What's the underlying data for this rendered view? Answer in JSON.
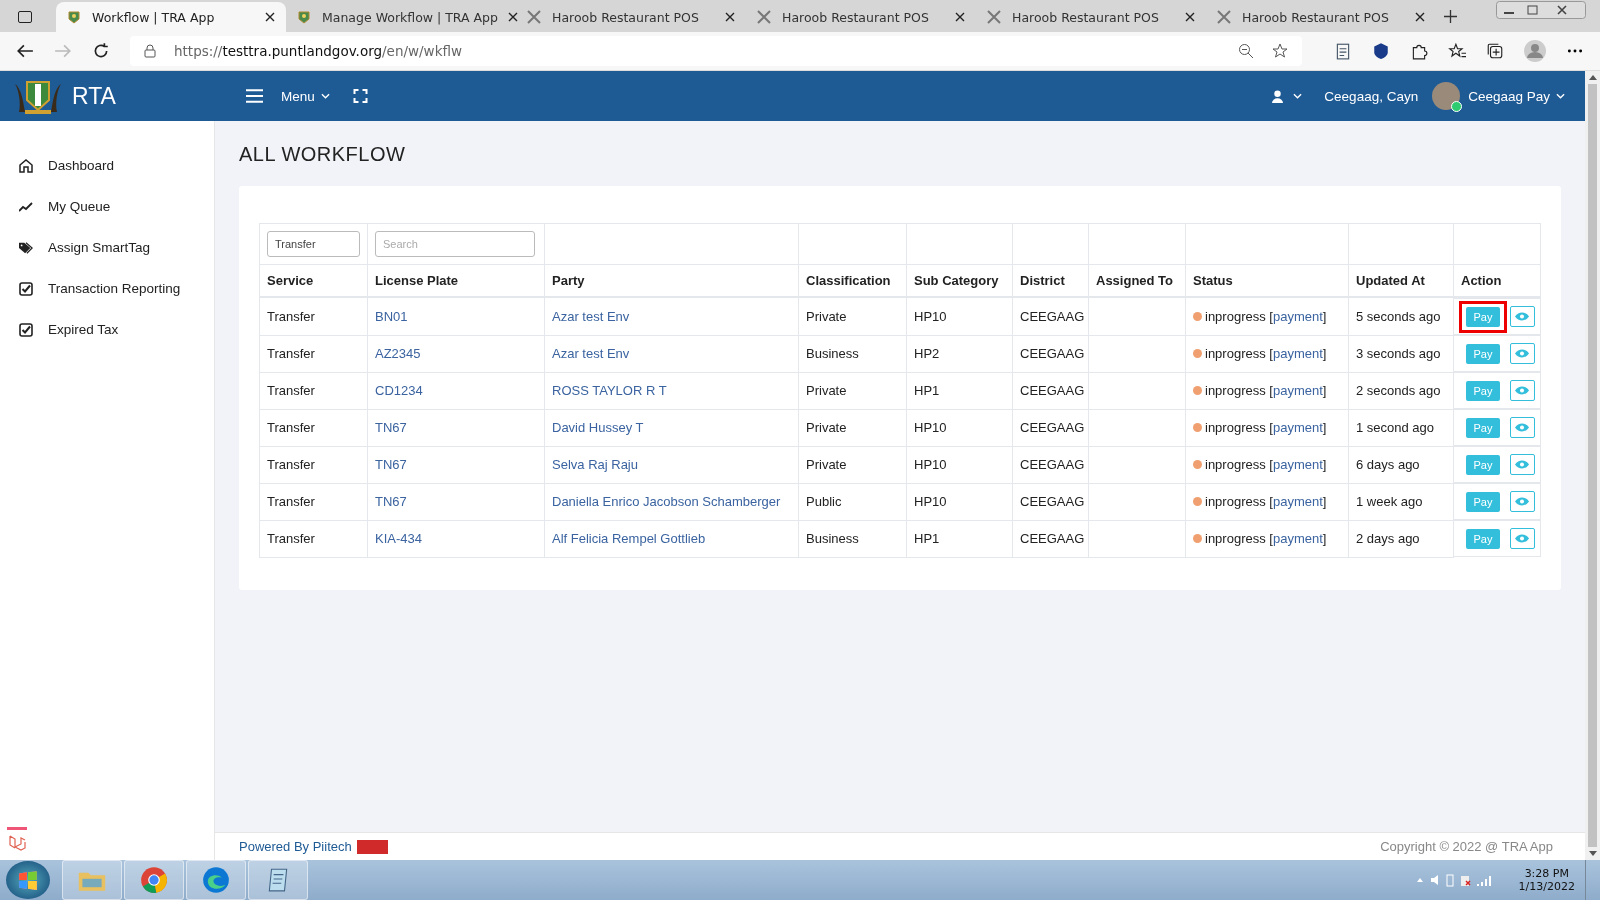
{
  "browser": {
    "tabs": [
      {
        "label": "Workflow | TRA App",
        "kind": "emblem",
        "selected": true
      },
      {
        "label": "Manage Workflow | TRA App",
        "kind": "emblem",
        "selected": false
      },
      {
        "label": "Haroob Restaurant POS",
        "kind": "utensils",
        "selected": false
      },
      {
        "label": "Haroob Restaurant POS",
        "kind": "utensils",
        "selected": false
      },
      {
        "label": "Haroob Restaurant POS",
        "kind": "utensils",
        "selected": false
      },
      {
        "label": "Haroob Restaurant POS",
        "kind": "utensils",
        "selected": false
      }
    ],
    "url": {
      "scheme": "https://",
      "host": "testtra.puntlandgov.org",
      "path": "/en/w/wkflw"
    }
  },
  "header": {
    "brand": "RTA",
    "menu": "Menu",
    "user_short": "Ceegaag, Cayn",
    "user_name": "Ceegaag Pay"
  },
  "sidebar": {
    "items": [
      {
        "label": "Dashboard",
        "kind": "home"
      },
      {
        "label": "My Queue",
        "kind": "trend"
      },
      {
        "label": "Assign SmartTag",
        "kind": "tags"
      },
      {
        "label": "Transaction Reporting",
        "kind": "check"
      },
      {
        "label": "Expired Tax",
        "kind": "check"
      }
    ]
  },
  "page": {
    "title": "ALL WORKFLOW"
  },
  "table": {
    "filters": {
      "service_value": "Transfer",
      "search_placeholder": "Search"
    },
    "columns": [
      "Service",
      "License Plate",
      "Party",
      "Classification",
      "Sub Category",
      "District",
      "Assigned To",
      "Status",
      "Updated At",
      "Action"
    ],
    "rows": [
      {
        "service": "Transfer",
        "plate": "BN01",
        "party": "Azar test Env",
        "classification": "Private",
        "sub_category": "HP10",
        "district": "CEEGAAG",
        "status": "inprogress",
        "status_link": "payment",
        "bracket_open": "[",
        "bracket_close": "]",
        "updated": "5 seconds ago",
        "pay": "Pay",
        "highlighted": true
      },
      {
        "service": "Transfer",
        "plate": "AZ2345",
        "party": "Azar test Env",
        "classification": "Business",
        "sub_category": "HP2",
        "district": "CEEGAAG",
        "status": "inprogress",
        "status_link": "payment",
        "bracket_open": "[",
        "bracket_close": "]",
        "updated": "3 seconds ago",
        "pay": "Pay",
        "highlighted": false
      },
      {
        "service": "Transfer",
        "plate": "CD1234",
        "party": "ROSS TAYLOR R T",
        "classification": "Private",
        "sub_category": "HP1",
        "district": "CEEGAAG",
        "status": "inprogress",
        "status_link": "payment",
        "bracket_open": "[",
        "bracket_close": "]",
        "updated": "2 seconds ago",
        "pay": "Pay",
        "highlighted": false
      },
      {
        "service": "Transfer",
        "plate": "TN67",
        "party": "David Hussey T",
        "classification": "Private",
        "sub_category": "HP10",
        "district": "CEEGAAG",
        "status": "inprogress",
        "status_link": "payment",
        "bracket_open": "[",
        "bracket_close": "]",
        "updated": "1 second ago",
        "pay": "Pay",
        "highlighted": false
      },
      {
        "service": "Transfer",
        "plate": "TN67",
        "party": "Selva Raj Raju",
        "classification": "Private",
        "sub_category": "HP10",
        "district": "CEEGAAG",
        "status": "inprogress",
        "status_link": "payment",
        "bracket_open": "[",
        "bracket_close": "]",
        "updated": "6 days ago",
        "pay": "Pay",
        "highlighted": false
      },
      {
        "service": "Transfer",
        "plate": "TN67",
        "party": "Daniella Enrico Jacobson Schamberger",
        "classification": "Public",
        "sub_category": "HP10",
        "district": "CEEGAAG",
        "status": "inprogress",
        "status_link": "payment",
        "bracket_open": "[",
        "bracket_close": "]",
        "updated": "1 week ago",
        "pay": "Pay",
        "highlighted": false
      },
      {
        "service": "Transfer",
        "plate": "KIA-434",
        "party": "Alf Felicia Rempel Gottlieb",
        "classification": "Business",
        "sub_category": "HP1",
        "district": "CEEGAAG",
        "status": "inprogress",
        "status_link": "payment",
        "bracket_open": "[",
        "bracket_close": "]",
        "updated": "2 days ago",
        "pay": "Pay",
        "highlighted": false
      }
    ]
  },
  "footer": {
    "powered": "Powered By Piitech",
    "copyright": "Copyright © 2022 @ TRA App"
  },
  "taskbar": {
    "time": "3:28 PM",
    "date": "1/13/2022"
  }
}
